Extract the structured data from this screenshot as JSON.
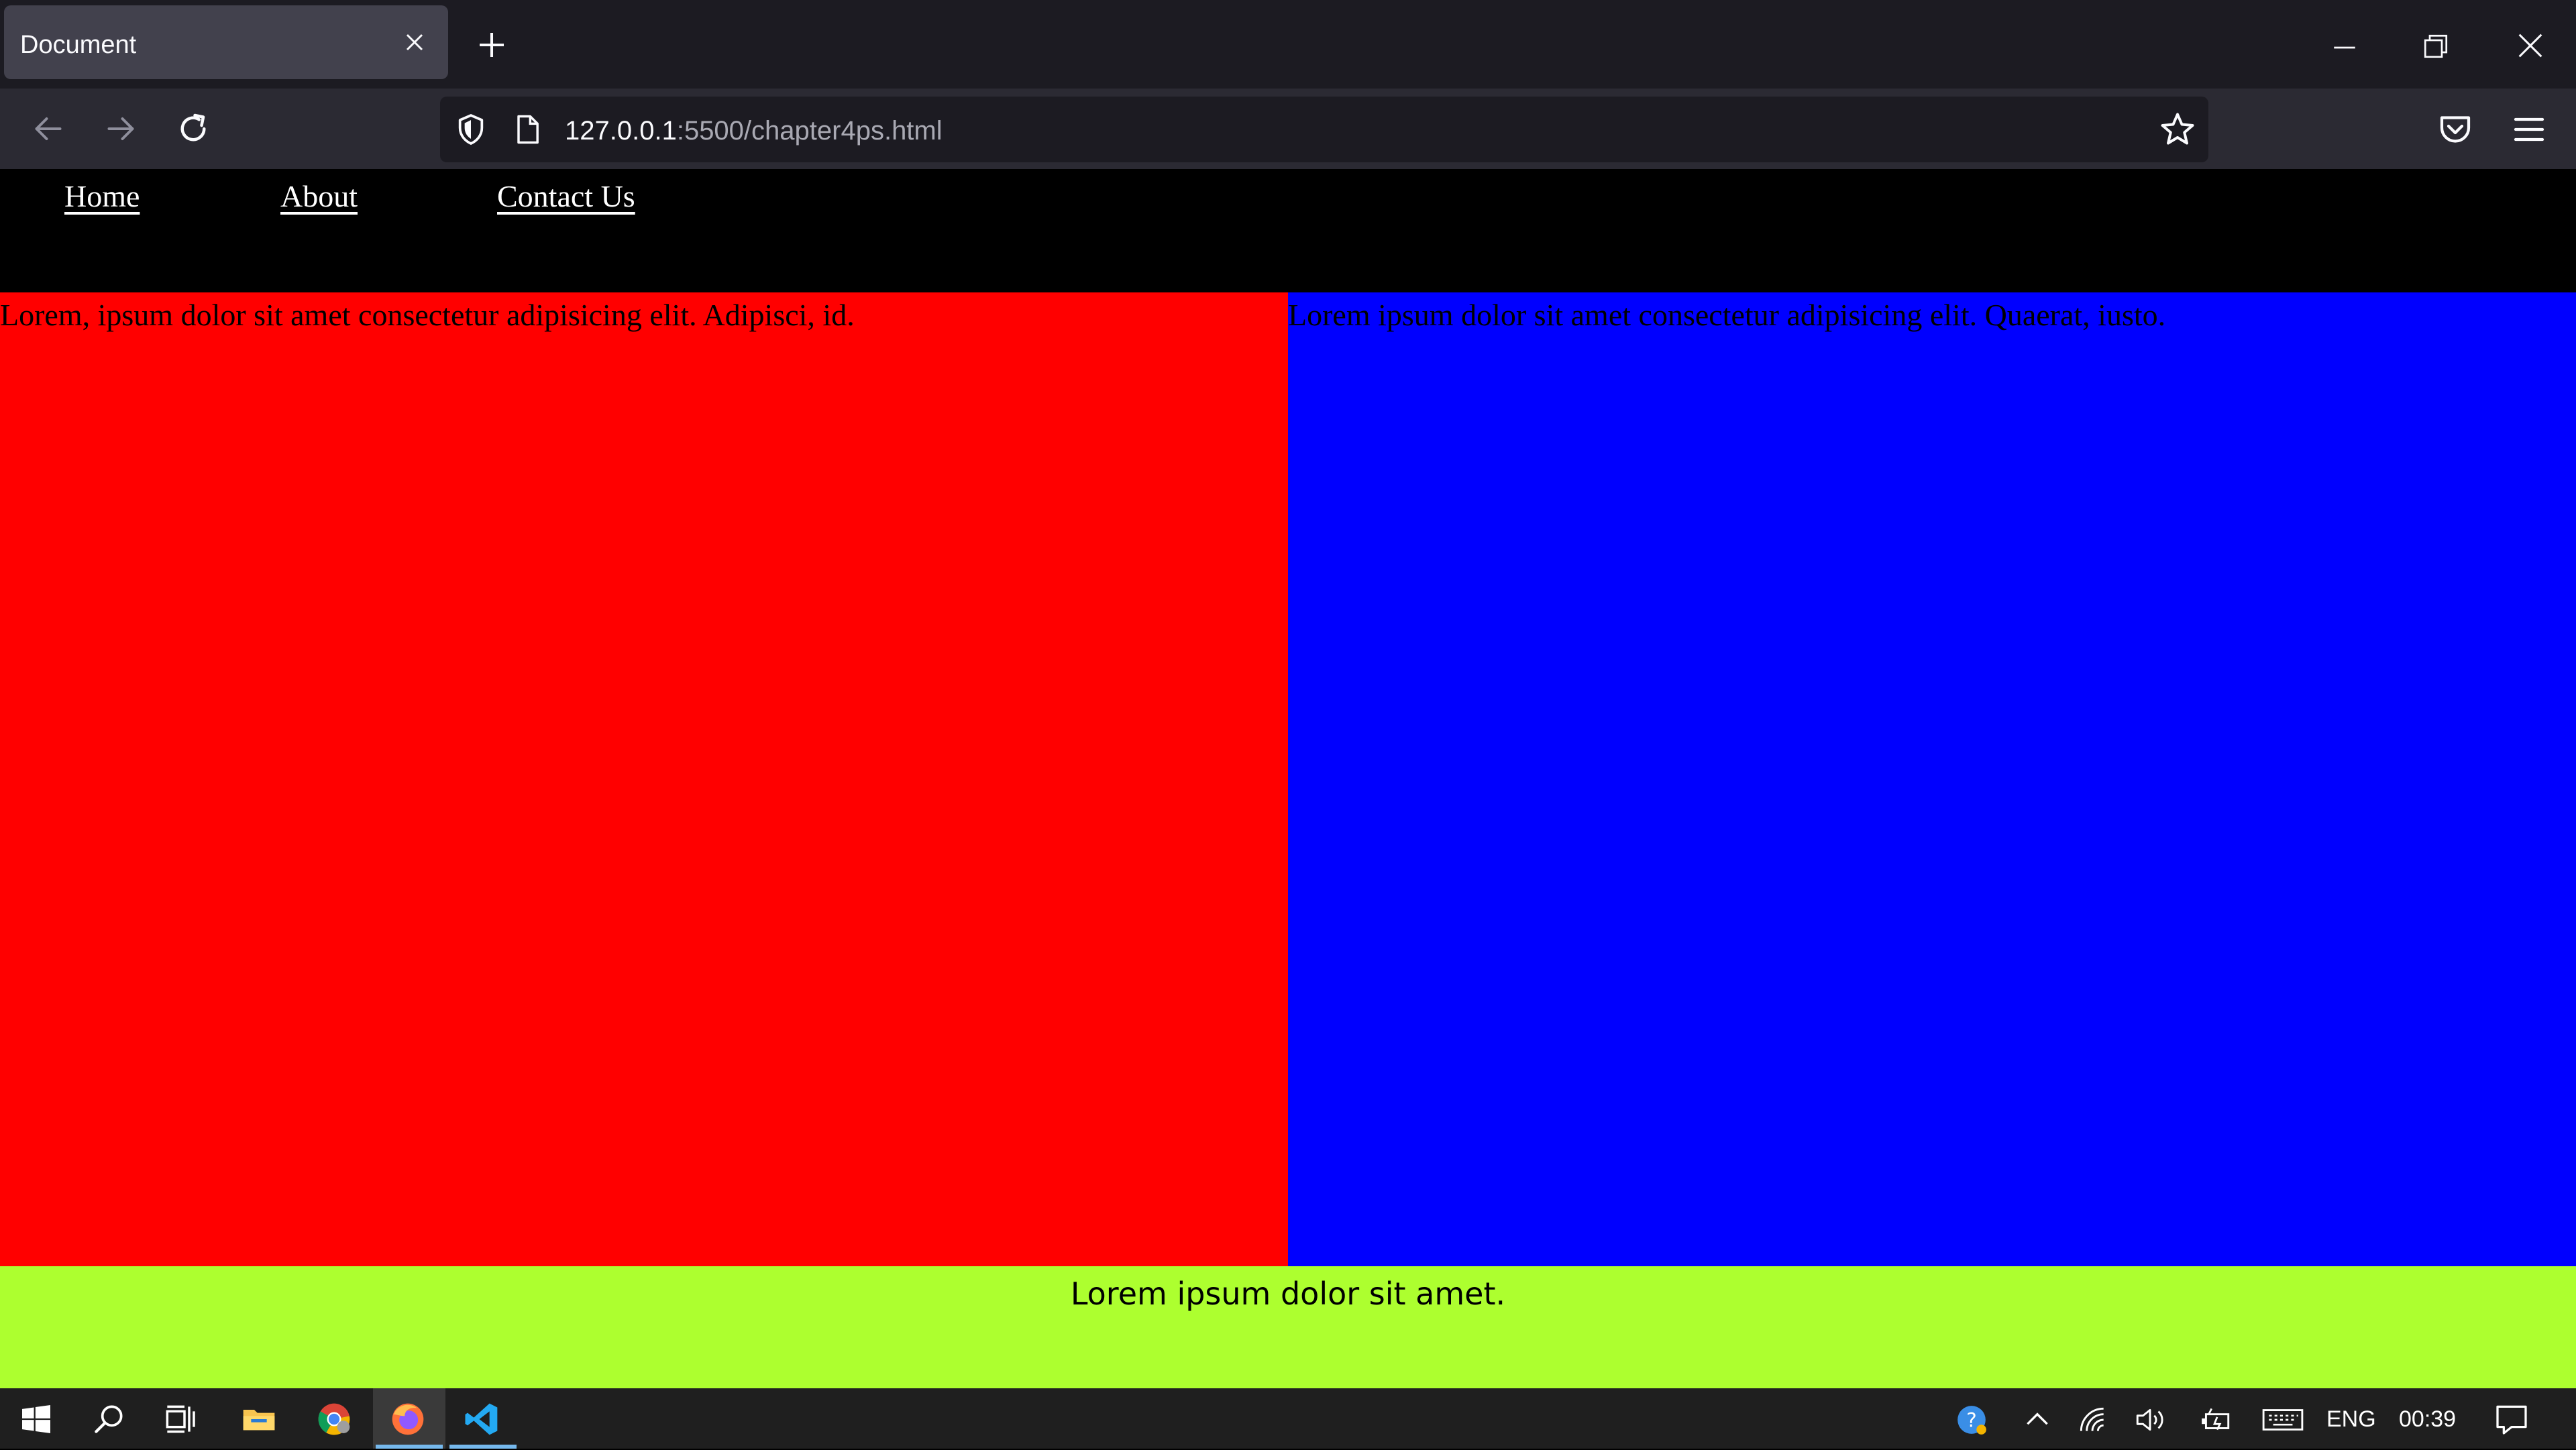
{
  "browser": {
    "tab_title": "Document",
    "url_host": "127.0.0.1",
    "url_path": ":5500/chapter4ps.html"
  },
  "site": {
    "nav": [
      {
        "label": "Home"
      },
      {
        "label": "About"
      },
      {
        "label": "Contact Us"
      }
    ],
    "left_text": "Lorem, ipsum dolor sit amet consectetur adipisicing elit. Adipisci, id.",
    "right_text": "Lorem ipsum dolor sit amet consectetur adipisicing elit. Quaerat, iusto.",
    "footer_text": "Lorem ipsum dolor sit amet.",
    "colors": {
      "nav_bg": "#000000",
      "left_bg": "#ff0000",
      "right_bg": "#0000ff",
      "footer_bg": "#adff2f"
    }
  },
  "taskbar": {
    "apps": [
      "start-icon",
      "search-icon",
      "taskview-icon",
      "file-explorer-icon",
      "chrome-icon",
      "firefox-icon",
      "vscode-icon"
    ],
    "language": "ENG",
    "clock": "00:39"
  }
}
